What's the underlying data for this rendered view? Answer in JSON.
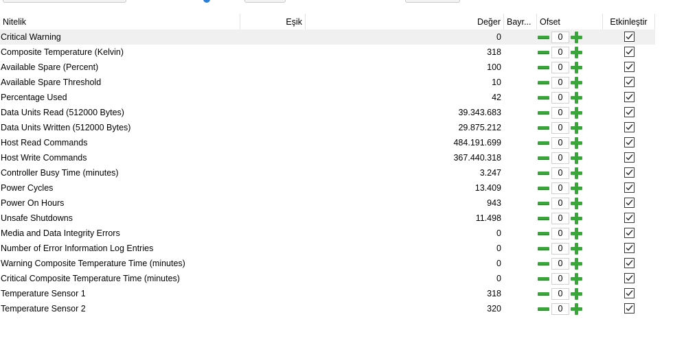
{
  "columns": {
    "name": "Nitelik",
    "threshold": "Eşik",
    "value": "Değer",
    "flags": "Bayr...",
    "offset": "Ofset",
    "enable": "Etkinleştir"
  },
  "selected_row": 0,
  "rows": [
    {
      "name": "Critical Warning",
      "value": "0",
      "offset": "0",
      "enabled": true
    },
    {
      "name": "Composite Temperature (Kelvin)",
      "value": "318",
      "offset": "0",
      "enabled": true
    },
    {
      "name": "Available Spare (Percent)",
      "value": "100",
      "offset": "0",
      "enabled": true
    },
    {
      "name": "Available Spare Threshold",
      "value": "10",
      "offset": "0",
      "enabled": true
    },
    {
      "name": "Percentage Used",
      "value": "42",
      "offset": "0",
      "enabled": true
    },
    {
      "name": "Data Units Read (512000 Bytes)",
      "value": "39.343.683",
      "offset": "0",
      "enabled": true
    },
    {
      "name": "Data Units Written (512000 Bytes)",
      "value": "29.875.212",
      "offset": "0",
      "enabled": true
    },
    {
      "name": "Host Read Commands",
      "value": "484.191.699",
      "offset": "0",
      "enabled": true
    },
    {
      "name": "Host Write Commands",
      "value": "367.440.318",
      "offset": "0",
      "enabled": true
    },
    {
      "name": "Controller Busy Time (minutes)",
      "value": "3.247",
      "offset": "0",
      "enabled": true
    },
    {
      "name": "Power Cycles",
      "value": "13.409",
      "offset": "0",
      "enabled": true
    },
    {
      "name": "Power On Hours",
      "value": "943",
      "offset": "0",
      "enabled": true
    },
    {
      "name": "Unsafe Shutdowns",
      "value": "11.498",
      "offset": "0",
      "enabled": true
    },
    {
      "name": "Media and Data Integrity Errors",
      "value": "0",
      "offset": "0",
      "enabled": true
    },
    {
      "name": "Number of Error Information Log Entries",
      "value": "0",
      "offset": "0",
      "enabled": true
    },
    {
      "name": "Warning Composite Temperature Time (minutes)",
      "value": "0",
      "offset": "0",
      "enabled": true
    },
    {
      "name": "Critical Composite Temperature Time (minutes)",
      "value": "0",
      "offset": "0",
      "enabled": true
    },
    {
      "name": "Temperature Sensor 1",
      "value": "318",
      "offset": "0",
      "enabled": true
    },
    {
      "name": "Temperature Sensor 2",
      "value": "320",
      "offset": "0",
      "enabled": true
    }
  ]
}
